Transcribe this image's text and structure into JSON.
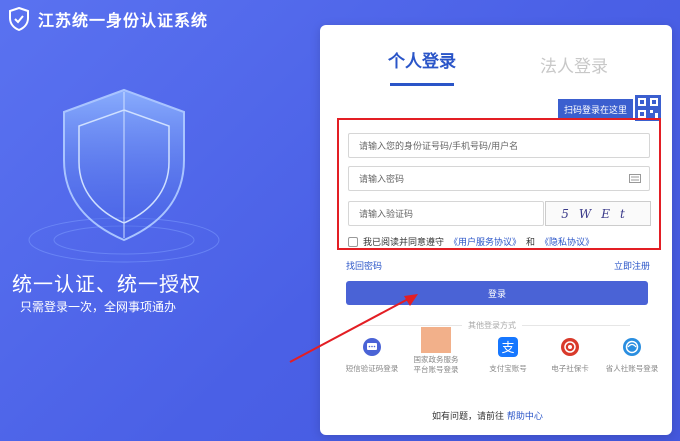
{
  "header": {
    "title": "江苏统一身份认证系统"
  },
  "hero": {
    "slogan": "统一认证、统一授权",
    "subslogan": "只需登录一次，全网事项通办"
  },
  "tabs": {
    "personal": "个人登录",
    "legal": "法人登录"
  },
  "qr_badge": {
    "label": "扫码登录在这里"
  },
  "form": {
    "id_placeholder": "请输入您的身份证号码/手机号码/用户名",
    "password_placeholder": "请输入密码",
    "captcha_placeholder": "请输入验证码",
    "captcha_text": "5WEt",
    "agree_prefix": "我已阅读并同意遵守",
    "service_agreement": "《用户服务协议》",
    "and": "和",
    "privacy_agreement": "《隐私协议》"
  },
  "links": {
    "forgot": "找回密码",
    "register": "立即注册"
  },
  "login_button": "登录",
  "other_logins": {
    "title": "其他登录方式",
    "items": [
      {
        "label": "短信验证码登录",
        "icon": "sms-icon",
        "color": "#4a63d6"
      },
      {
        "label_line1": "国家政务服务",
        "label_line2": "平台账号登录",
        "icon": "gov-platform-photo"
      },
      {
        "label": "支付宝账号",
        "icon": "alipay-icon",
        "color": "#1677ff"
      },
      {
        "label": "电子社保卡",
        "icon": "social-security-card-icon",
        "color": "#d93a2b"
      },
      {
        "label": "省人社账号登录",
        "icon": "hr-account-icon",
        "color": "#2a8ee0"
      }
    ]
  },
  "help": {
    "prefix": "如有问题，请前往 ",
    "link": "帮助中心"
  },
  "colors": {
    "accent": "#4a63d6",
    "highlight_border": "#e31e24",
    "background": "#5a72f0"
  }
}
